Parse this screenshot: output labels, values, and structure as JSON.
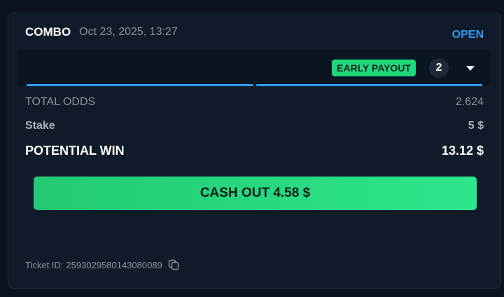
{
  "bet": {
    "type": "COMBO",
    "date": "Oct 23, 2025, 13:27",
    "status": "OPEN"
  },
  "legs": {
    "badge": "EARLY PAYOUT",
    "count": "2",
    "expand_icon": "caret-down-icon",
    "progress_segments": 2
  },
  "summary": {
    "total_odds_label": "TOTAL ODDS",
    "total_odds_value": "2.624",
    "stake_label": "Stake",
    "stake_value": "5 $",
    "potential_win_label": "POTENTIAL WIN",
    "potential_win_value": "13.12 $"
  },
  "cashout": {
    "label": "CASH OUT 4.58 $"
  },
  "ticket": {
    "label": "Ticket ID:",
    "id": "2593029580143080089",
    "copy_icon": "copy-icon"
  },
  "colors": {
    "accent_blue": "#2b9bf4",
    "accent_green": "#1fd87c",
    "background": "#0f1b29"
  }
}
